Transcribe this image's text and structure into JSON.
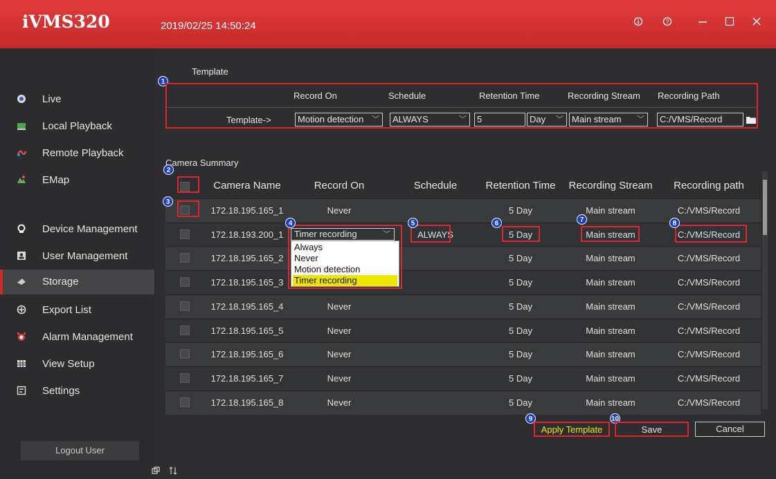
{
  "app": {
    "title": "iVMS320",
    "datetime": "2019/02/25 14:50:24"
  },
  "window_controls": {
    "info": "ⓘ",
    "help": "?",
    "minimize": "—",
    "maximize": "☐",
    "close": "✕"
  },
  "sidebar": {
    "items": [
      {
        "label": "Live",
        "icon": "live-icon"
      },
      {
        "label": "Local Playback",
        "icon": "local-playback-icon"
      },
      {
        "label": "Remote Playback",
        "icon": "remote-playback-icon"
      },
      {
        "label": "EMap",
        "icon": "emap-icon"
      },
      {
        "label": "Device Management",
        "icon": "device-management-icon"
      },
      {
        "label": "User Management",
        "icon": "user-management-icon"
      },
      {
        "label": "Storage",
        "icon": "storage-icon",
        "active": true
      },
      {
        "label": "Export List",
        "icon": "export-list-icon"
      },
      {
        "label": "Alarm Management",
        "icon": "alarm-icon"
      },
      {
        "label": "View Setup",
        "icon": "view-setup-icon"
      },
      {
        "label": "Settings",
        "icon": "settings-icon"
      }
    ],
    "logout_label": "Logout User"
  },
  "template": {
    "section_title": "Template",
    "headers": [
      "Record On",
      "Schedule",
      "Retention Time",
      "Recording Stream",
      "Recording Path"
    ],
    "row_label": "Template->",
    "record_on": "Motion detection",
    "schedule": "ALWAYS",
    "retention_value": "5",
    "retention_unit": "Day",
    "stream": "Main stream",
    "path": "C:/VMS/Record"
  },
  "summary": {
    "section_title": "Camera Summary",
    "headers": [
      "Camera Name",
      "Record On",
      "Schedule",
      "Retention Time",
      "Recording Stream",
      "Recording path"
    ],
    "rows": [
      {
        "name": "172.18.195.165_1",
        "record_on": "Never",
        "schedule": "",
        "retention": "5 Day",
        "stream": "Main stream",
        "path": "C:/VMS/Record"
      },
      {
        "name": "172.18.193.200_1",
        "record_on": "Timer recording",
        "schedule": "ALWAYS",
        "retention": "5 Day",
        "stream": "Main stream",
        "path": "C:/VMS/Record"
      },
      {
        "name": "172.18.195.165_2",
        "record_on": "",
        "schedule": "",
        "retention": "5 Day",
        "stream": "Main stream",
        "path": "C:/VMS/Record"
      },
      {
        "name": "172.18.195.165_3",
        "record_on": "",
        "schedule": "",
        "retention": "5 Day",
        "stream": "Main stream",
        "path": "C:/VMS/Record"
      },
      {
        "name": "172.18.195.165_4",
        "record_on": "Never",
        "schedule": "",
        "retention": "5 Day",
        "stream": "Main stream",
        "path": "C:/VMS/Record"
      },
      {
        "name": "172.18.195.165_5",
        "record_on": "Never",
        "schedule": "",
        "retention": "5 Day",
        "stream": "Main stream",
        "path": "C:/VMS/Record"
      },
      {
        "name": "172.18.195.165_6",
        "record_on": "Never",
        "schedule": "",
        "retention": "5 Day",
        "stream": "Main stream",
        "path": "C:/VMS/Record"
      },
      {
        "name": "172.18.195.165_7",
        "record_on": "Never",
        "schedule": "",
        "retention": "5 Day",
        "stream": "Main stream",
        "path": "C:/VMS/Record"
      },
      {
        "name": "172.18.195.165_8",
        "record_on": "Never",
        "schedule": "",
        "retention": "5 Day",
        "stream": "Main stream",
        "path": "C:/VMS/Record"
      }
    ],
    "dropdown_options": [
      "Always",
      "Never",
      "Motion detection",
      "Timer recording"
    ],
    "dropdown_selected": "Timer recording"
  },
  "badges": [
    "1",
    "2",
    "3",
    "4",
    "5",
    "6",
    "7",
    "8",
    "9",
    "10"
  ],
  "buttons": {
    "apply_template": "Apply Template",
    "save": "Save",
    "cancel": "Cancel"
  },
  "colors": {
    "titlebar": "#d63333",
    "highlight": "#e0262a",
    "badge": "#1a3fc4",
    "apply_text": "#f0e500",
    "selected_option": "#f0e500"
  }
}
